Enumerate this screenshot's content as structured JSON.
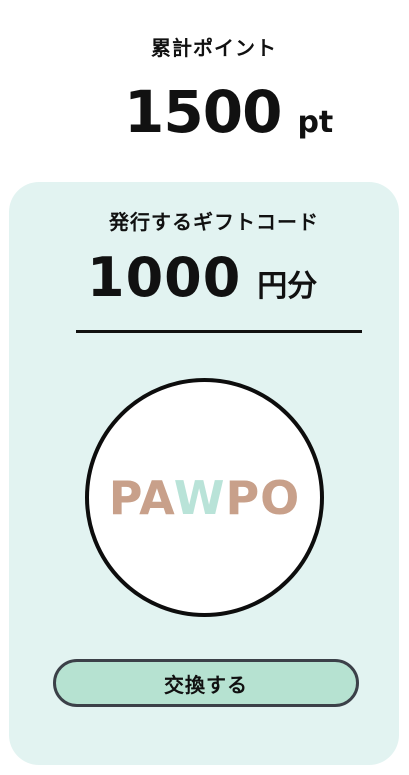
{
  "points": {
    "label": "累計ポイント",
    "value": "1500",
    "unit": "pt"
  },
  "gift_card": {
    "title": "発行するギフトコード",
    "amount": "1000",
    "amount_unit": "円分",
    "logo": {
      "part1": "PA",
      "part2": "W",
      "part3": "PO",
      "colors": {
        "letters": "#c8a08a",
        "w_letter": "#b9e3d8"
      }
    },
    "exchange_button_label": "交換する"
  },
  "colors": {
    "card_background": "#e2f3f1",
    "button_background": "#b6e2d1",
    "button_border": "#3b4048"
  }
}
